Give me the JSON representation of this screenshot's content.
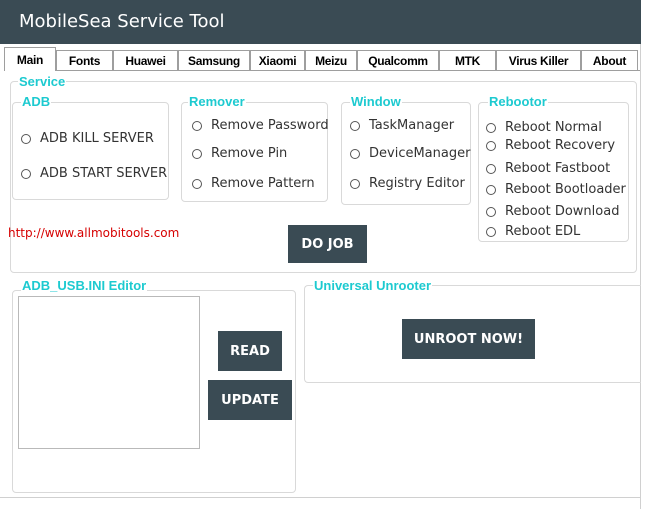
{
  "window": {
    "title": "MobileSea Service Tool"
  },
  "tabs": [
    {
      "label": "Main",
      "active": true
    },
    {
      "label": "Fonts"
    },
    {
      "label": "Huawei"
    },
    {
      "label": "Samsung"
    },
    {
      "label": "Xiaomi"
    },
    {
      "label": "Meizu"
    },
    {
      "label": "Qualcomm"
    },
    {
      "label": "MTK"
    },
    {
      "label": "Virus Killer"
    },
    {
      "label": "About"
    }
  ],
  "service": {
    "title": "Service",
    "adb": {
      "title": "ADB",
      "options": [
        "ADB KILL SERVER",
        "ADB START SERVER"
      ]
    },
    "remover": {
      "title": "Remover",
      "options": [
        "Remove Password",
        "Remove Pin",
        "Remove Pattern"
      ]
    },
    "window": {
      "title": "Window",
      "options": [
        "TaskManager",
        "DeviceManager",
        "Registry Editor"
      ]
    },
    "rebootor": {
      "title": "Rebootor",
      "options": [
        "Reboot Normal",
        "Reboot Recovery",
        "Reboot Fastboot",
        "Reboot Bootloader",
        "Reboot Download",
        "Reboot EDL"
      ]
    },
    "link": "http://www.allmobitools.com",
    "do_job": "DO JOB"
  },
  "adb_usb": {
    "title": "ADB_USB.INI Editor",
    "read": "READ",
    "update": "UPDATE",
    "value": ""
  },
  "unrooter": {
    "title": "Universal Unrooter",
    "button": "UNROOT NOW!"
  },
  "colors": {
    "accent": "#1dcad0",
    "dark": "#3a4b54",
    "link": "#d60000"
  }
}
